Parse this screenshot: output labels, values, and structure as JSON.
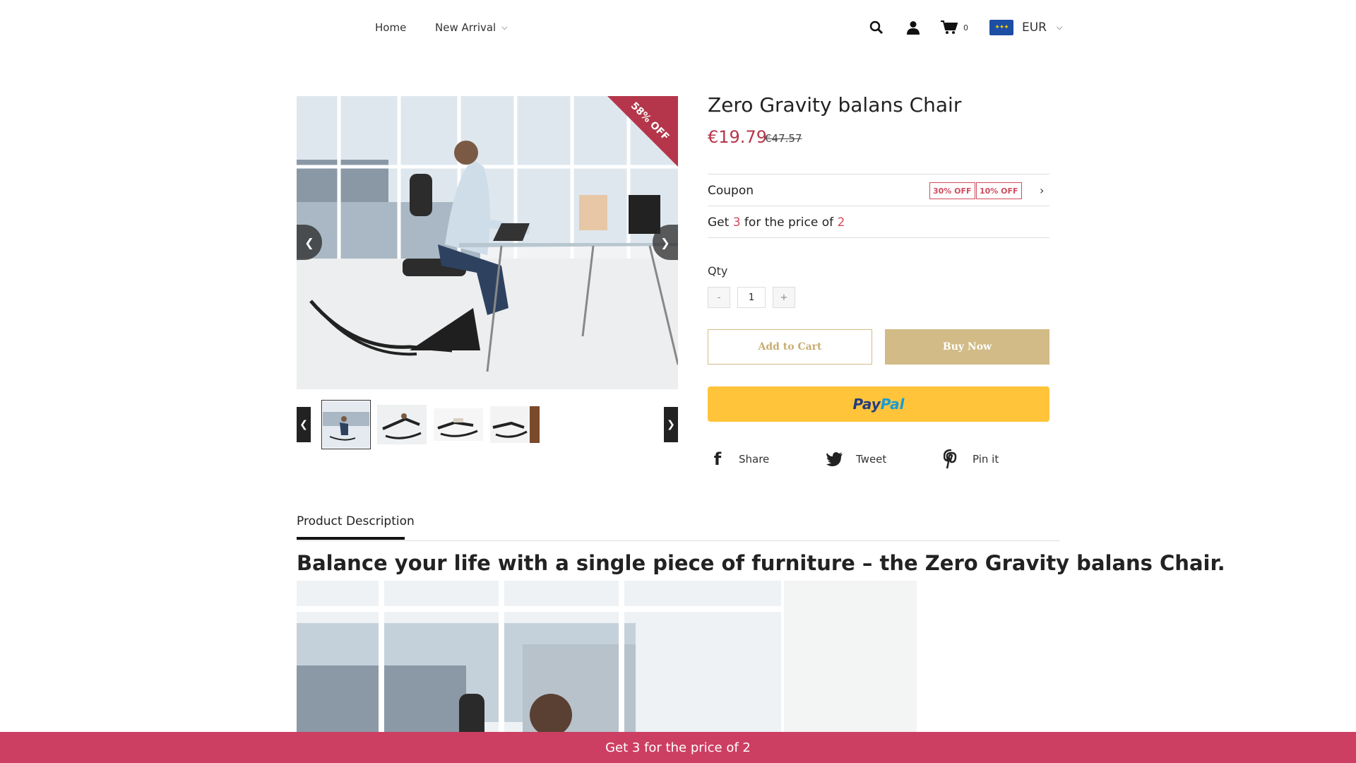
{
  "nav": {
    "home": "Home",
    "new_arrival": "New Arrival",
    "cart_count": "0",
    "currency": "EUR"
  },
  "gallery": {
    "badge": "58% OFF"
  },
  "product": {
    "title": "Zero Gravity balans Chair",
    "price": "€19.79",
    "old_price": "€47.57"
  },
  "coupon": {
    "label": "Coupon",
    "tags": [
      "30% OFF",
      "10% OFF"
    ]
  },
  "promo": {
    "prefix": "Get ",
    "n1": "3",
    "mid": " for the price of ",
    "n2": "2"
  },
  "qty": {
    "label": "Qty",
    "minus": "-",
    "value": "1",
    "plus": "+"
  },
  "buttons": {
    "add_to_cart": "Add to Cart",
    "buy_now": "Buy Now",
    "paypal_1": "Pay",
    "paypal_2": "Pal"
  },
  "share": {
    "share": "Share",
    "tweet": "Tweet",
    "pin": "Pin it"
  },
  "description": {
    "tab": "Product Description",
    "heading": "Balance your life with a single piece of furniture – the Zero Gravity balans Chair."
  },
  "bottom_bar": "Get 3 for the price of 2",
  "colors": {
    "accent": "#cd3f62",
    "price": "#b5364a",
    "gold": "#d2bb86",
    "paypal": "#ffc439"
  }
}
